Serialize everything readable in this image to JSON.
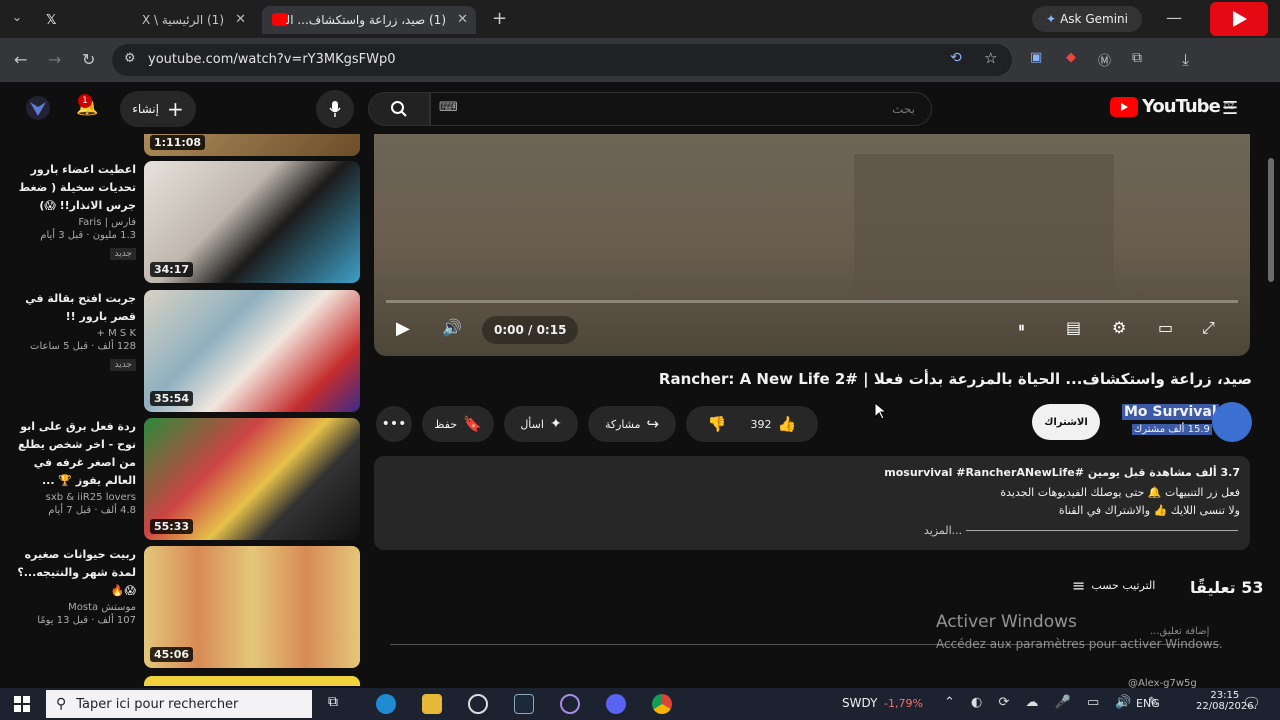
{
  "browser": {
    "tabs": [
      {
        "label": "(1) الرئيسية \\ X"
      },
      {
        "label": "(1) صيد، زراعة واستكشاف... الحياة"
      }
    ],
    "ask_gemini": "Ask Gemini",
    "url": "youtube.com/watch?v=rY3MKgsFWp0",
    "counter": "103"
  },
  "youtube": {
    "search_placeholder": "بحث",
    "create_label": "إنشاء",
    "notification_count": "1",
    "logo_text": "YouTube",
    "logo_region": "DZ"
  },
  "player": {
    "time": "0:00 / 0:15"
  },
  "video": {
    "title": "صيد، زراعة واستكشاف... الحياة بالمزرعة بدأت فعلا | Rancher: A New Life 2#",
    "channel": "Mo Survival",
    "subscribers": "15.9 ألف مشترك",
    "subscribe_label": "الاشتراك",
    "likes": "392",
    "share_label": "مشاركة",
    "ask_label": "اسأل",
    "save_label": "حفظ"
  },
  "description": {
    "line1": "3.7 ألف مشاهدة  قبل يومين  #mosurvival #RancherANewLife",
    "line2": "فعل زر التنبيهات 🔔 حتى يوصلك الفيديوهات الجديدة",
    "line3": "ولا تنسى اللايك 👍 والاشتراك في القناة",
    "more": "...المزيد"
  },
  "comments": {
    "count": "53 تعليقًا",
    "sort_label": "الترتيب حسب",
    "add_placeholder": "إضافة تعليق...",
    "partial_author": "@Alex-g7w5g"
  },
  "sidebar": {
    "items": [
      {
        "duration": "1:11:08",
        "title": "",
        "channel": "",
        "meta": "",
        "badge": ""
      },
      {
        "duration": "34:17",
        "title": "اعطيت اعضاء بارور تحديات سخيلة ( ضغط جرس الانذار!! 😱)",
        "channel": "فارس | Faris",
        "meta": "1.3 مليون · قبل 3 أيام",
        "badge": "جديد"
      },
      {
        "duration": "35:54",
        "title": "جربت افتح بقالة في قصر بارور !!",
        "channel": "M S K +",
        "meta": "128 ألف · قبل 5 ساعات",
        "badge": "جديد"
      },
      {
        "duration": "55:33",
        "title": "ردة فعل برق على ابو نوح - اخر شخص يطلع من اصغر غرفه في العالم يفوز 🏆 ...",
        "channel": "sxb & iiR25 lovers",
        "meta": "4.8 ألف · قبل 7 أيام",
        "badge": ""
      },
      {
        "duration": "45:06",
        "title": "ربيت حيوانات صغيره لمدة شهر والنتيجه...؟ 😱🔥",
        "channel": "موستش Mosta",
        "meta": "107 ألف · قبل 13 يومًا",
        "badge": ""
      }
    ]
  },
  "windows": {
    "activate_title": "Activer Windows",
    "activate_sub": "Accédez aux paramètres pour activer Windows.",
    "search_placeholder": "Taper ici pour rechercher",
    "stock_name": "SWDY",
    "stock_change": "-1,79%",
    "language": "ENG",
    "time": "23:15",
    "date": "22/08/2026"
  },
  "colors": {
    "background": "#0f0f0f",
    "accent_red": "#ff0000",
    "surface": "#272727",
    "highlight_blue": "#3d5aa6"
  }
}
